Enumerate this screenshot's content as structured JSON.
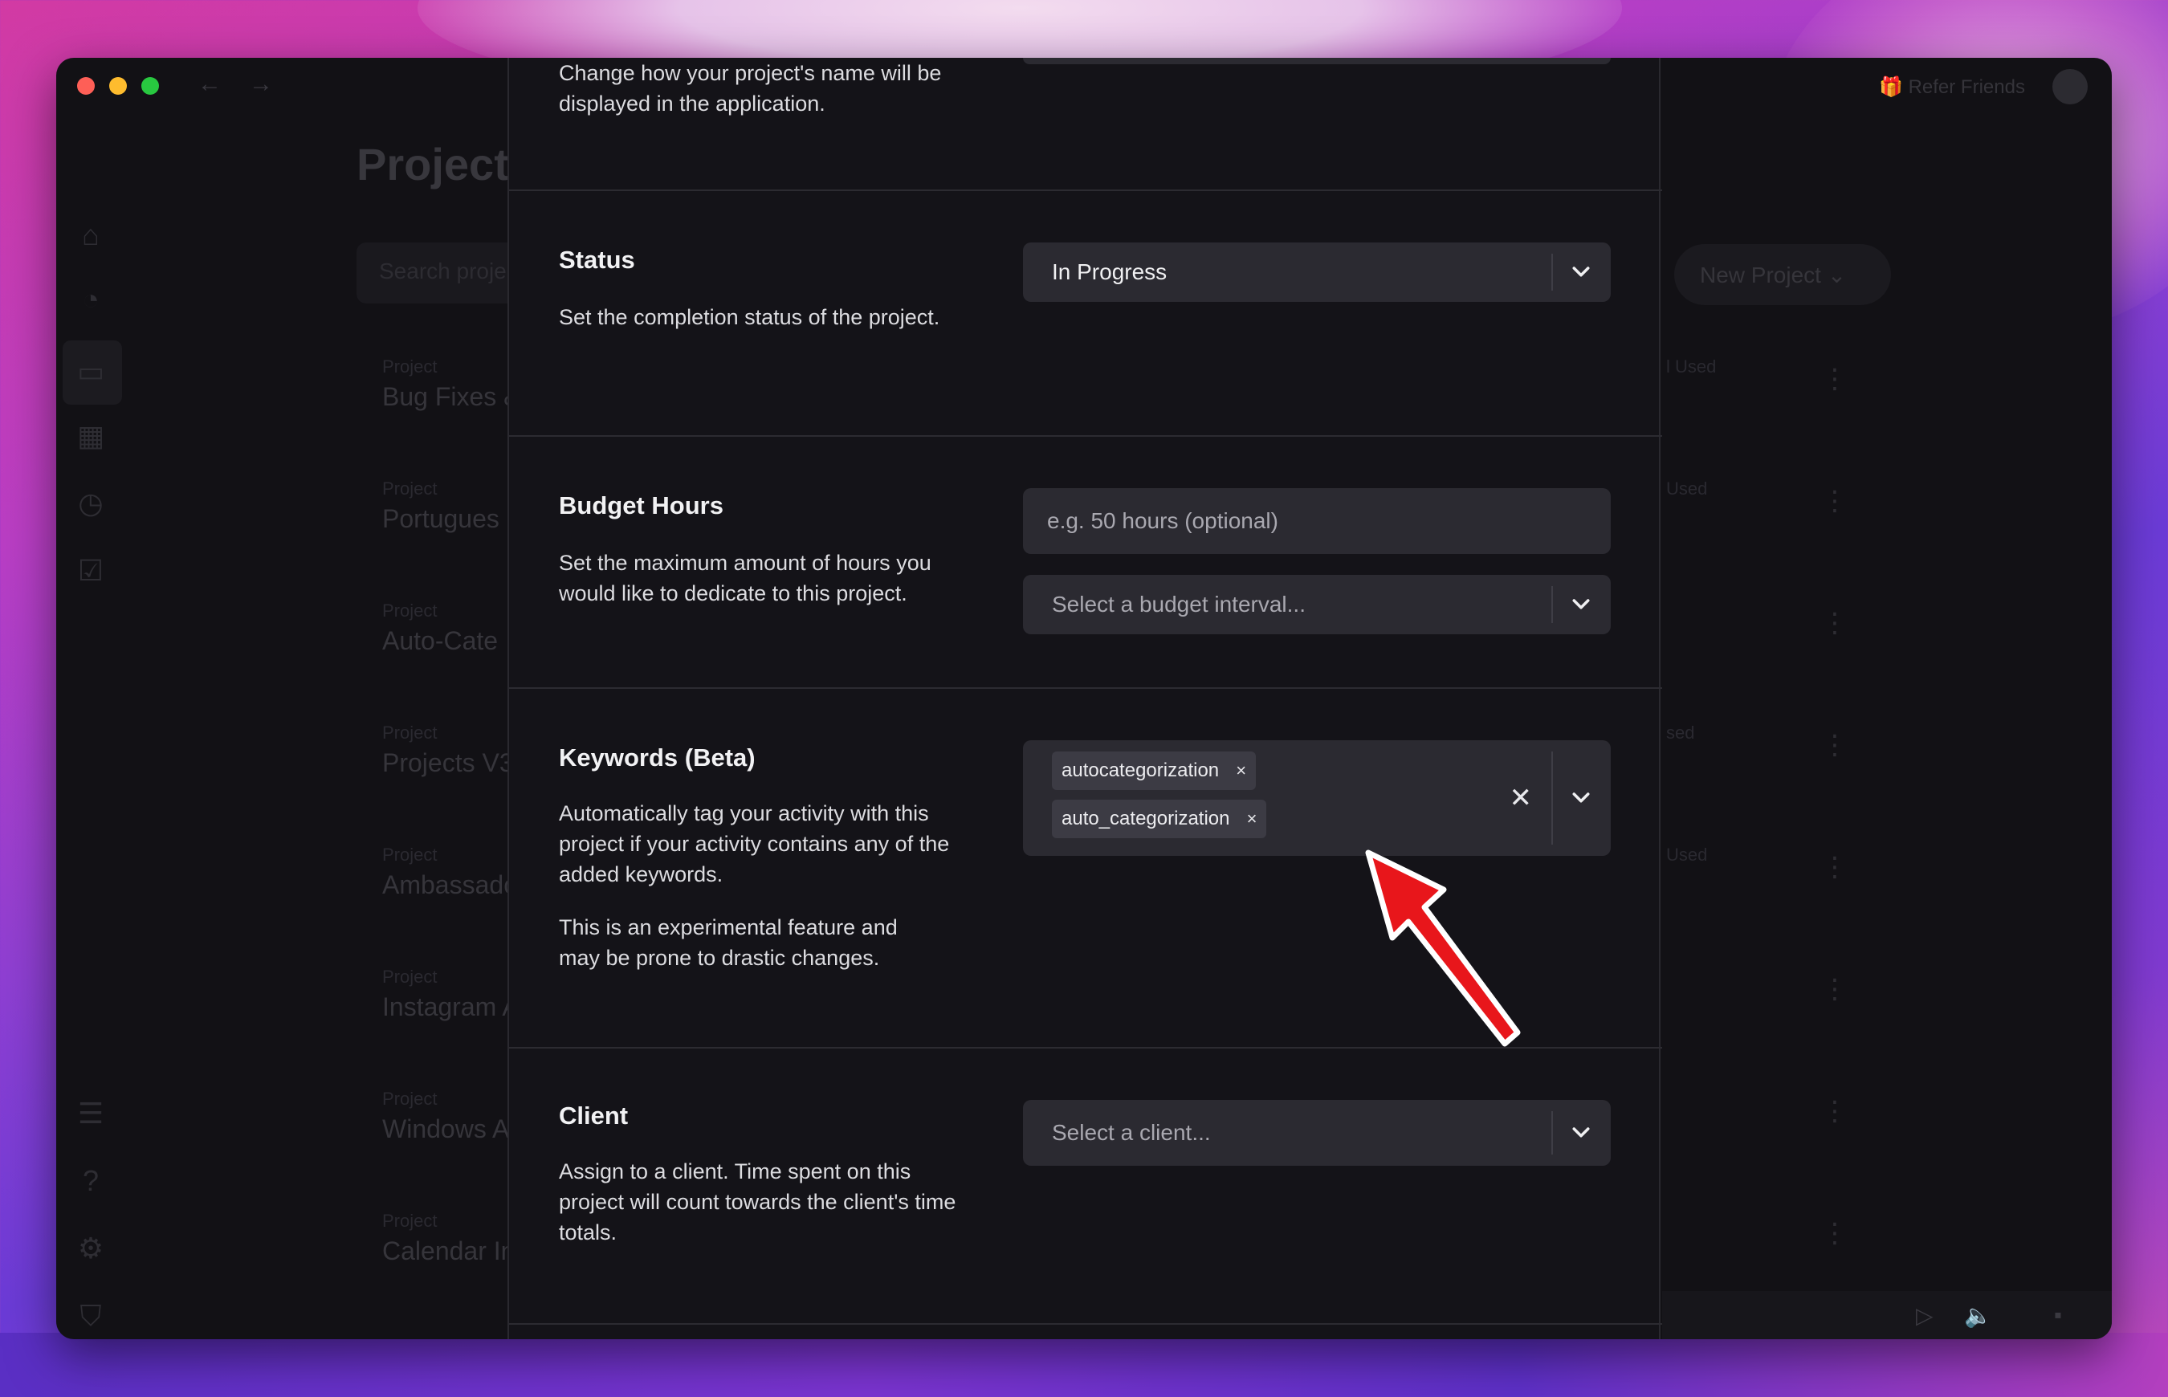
{
  "window": {
    "nav_back": "←",
    "nav_forward": "→",
    "refer_friends": "Refer Friends"
  },
  "background_page": {
    "title": "Project",
    "search_placeholder": "Search proje",
    "new_project_label": "New Project",
    "row_label": "Project",
    "rows": [
      "Bug Fixes &",
      "Portugues",
      "Auto-Cate",
      "Projects V3",
      "Ambassado",
      "Instagram A",
      "Windows A",
      "Calendar In"
    ],
    "used_labels": [
      "l Used",
      "Used",
      "",
      "sed",
      "Used"
    ]
  },
  "modal": {
    "name_section": {
      "desc": "Change how your project's name will be displayed in the application."
    },
    "status_section": {
      "title": "Status",
      "desc": "Set the completion status of the project.",
      "selected": "In Progress"
    },
    "budget_section": {
      "title": "Budget Hours",
      "desc": "Set the maximum amount of hours you would like to dedicate to this project.",
      "hours_placeholder": "e.g. 50 hours (optional)",
      "interval_placeholder": "Select a budget interval..."
    },
    "keywords_section": {
      "title": "Keywords (Beta)",
      "desc1": "Automatically tag your activity with this project if your activity contains any of the added keywords.",
      "desc2": "This is an experimental feature and may be prone to drastic changes.",
      "tags": [
        "autocategorization",
        "auto_categorization"
      ],
      "tag_remove": "×",
      "clear_all": "✕"
    },
    "client_section": {
      "title": "Client",
      "desc": "Assign to a client. Time spent on this project will count towards the client's time totals.",
      "placeholder": "Select a client..."
    }
  },
  "colors": {
    "modal_bg": "#141318",
    "field_bg": "#2b2a31",
    "tag_bg": "#3c3b44",
    "arrow": "#e8161b"
  },
  "icons": [
    "chevron-down-icon",
    "close-icon",
    "home-icon",
    "pie-chart-icon",
    "folder-icon",
    "calendar-icon",
    "clock-icon",
    "checkbox-icon",
    "list-icon",
    "help-icon",
    "gear-icon",
    "shield-icon",
    "gift-icon",
    "play-icon",
    "volume-icon",
    "chat-icon"
  ]
}
